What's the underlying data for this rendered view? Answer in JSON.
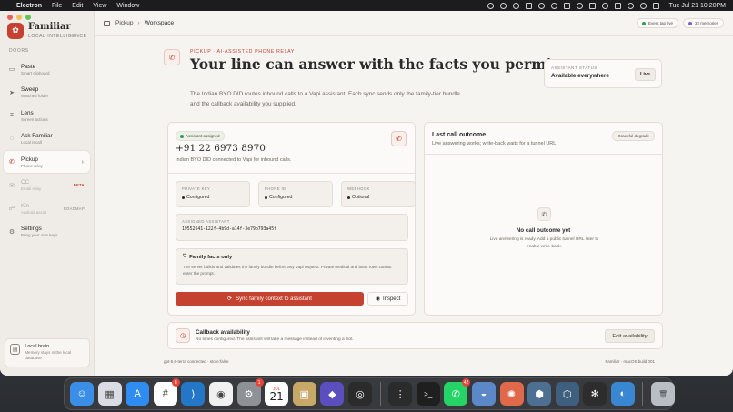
{
  "menubar": {
    "app_name": "Electron",
    "items": [
      "File",
      "Edit",
      "View",
      "Window"
    ],
    "clock": "Tue Jul 21  10:20PM"
  },
  "sidebar": {
    "brand_title": "Familiar",
    "brand_subtitle": "LOCAL INTELLIGENCE",
    "section_label": "DOORS",
    "items": [
      {
        "title": "Paste",
        "subtitle": "Smart clipboard",
        "icon": "clipboard-icon",
        "glyph": "▭"
      },
      {
        "title": "Sweep",
        "subtitle": "Watched folder",
        "icon": "send-icon",
        "glyph": "➤"
      },
      {
        "title": "Lens",
        "subtitle": "Screen actions",
        "icon": "crop-icon",
        "glyph": "⌗"
      },
      {
        "title": "Ask Familiar",
        "subtitle": "Local recall",
        "icon": "chat-icon",
        "glyph": "◌"
      },
      {
        "title": "Pickup",
        "subtitle": "Phone relay",
        "icon": "phone-icon",
        "glyph": "✆"
      },
      {
        "title": "CC",
        "subtitle": "Email relay",
        "icon": "mail-icon",
        "glyph": "✉",
        "badge": "BETA"
      },
      {
        "title": "Kin",
        "subtitle": "Android assist",
        "icon": "share-icon",
        "glyph": "☍",
        "badge": "ROADMAP"
      },
      {
        "title": "Settings",
        "subtitle": "Bring your own keys",
        "icon": "gear-icon",
        "glyph": "⚙"
      }
    ],
    "local_brain_title": "Local brain",
    "local_brain_desc": "Memory stays in the local database"
  },
  "topbar": {
    "crumb_root": "Pickup",
    "crumb_sep": "›",
    "crumb_current": "Workspace",
    "pill_event": "Event tap live",
    "pill_memories": "32 memories"
  },
  "hero": {
    "eyebrow": "PICKUP · AI-ASSISTED PHONE RELAY",
    "title": "Your line can answer with the facts you permit.",
    "description": "The Indian BYO DID routes inbound calls to a Vapi assistant. Each sync sends only the family-tier bundle and the callback availability you supplied."
  },
  "status": {
    "label": "ASSISTANT STATUS",
    "value": "Available everywhere",
    "badge": "Live"
  },
  "line_card": {
    "badge": "Assistant assigned",
    "phone": "+91 22 6973 8970",
    "description": "Indian BYO DID connected to Vapi for inbound calls.",
    "config": [
      {
        "label": "PRIVATE KEY",
        "value": "Configured"
      },
      {
        "label": "PHONE ID",
        "value": "Configured"
      },
      {
        "label": "WEBHOOK",
        "value": "Optional"
      }
    ],
    "assistant_label": "ASSIGNED ASSISTANT",
    "assistant_id": "19552641-122f-4b9d-a14f-3e79b793a45f",
    "facts_title": "Family facts only",
    "facts_desc": "The server builds and validates the family bundle before any Vapi request. Private medical and bank rows cannot enter the prompt.",
    "sync_label": "Sync family context to assistant",
    "inspect_label": "Inspect"
  },
  "outcome": {
    "title": "Last call outcome",
    "description": "Live answering works; write-back waits for a tunnel URL.",
    "pill": "Graceful degrade",
    "empty_title": "No call outcome yet",
    "empty_desc": "Live answering is ready. Add a public tunnel URL later to enable write-back."
  },
  "callback": {
    "title": "Callback availability",
    "description": "No times configured. The assistant will take a message instead of inventing a slot.",
    "button": "Edit availability"
  },
  "footer": {
    "left": "gpt-5.6-terra connected · store:false",
    "right": "Familiar · macOS build 001"
  },
  "dock": {
    "apps": [
      {
        "name": "finder-icon",
        "color": "#3a8ee6",
        "glyph": "☺"
      },
      {
        "name": "launchpad-icon",
        "color": "#d9dde3",
        "glyph": "▦"
      },
      {
        "name": "app-store-icon",
        "color": "#2f8cf0",
        "glyph": "A"
      },
      {
        "name": "slack-icon",
        "color": "#ffffff",
        "glyph": "#",
        "badge": "8"
      },
      {
        "name": "vscode-icon",
        "color": "#2477c7",
        "glyph": "⟩"
      },
      {
        "name": "chrome-icon",
        "color": "#f1f1f1",
        "glyph": "◉"
      },
      {
        "name": "system-settings-icon",
        "color": "#8e9297",
        "glyph": "⚙",
        "badge": "1"
      },
      {
        "name": "calendar-icon",
        "color": "#ffffff",
        "calendar": true
      },
      {
        "name": "preview-icon",
        "color": "#c7a869",
        "glyph": "▣"
      },
      {
        "name": "proton-vpn-icon",
        "color": "#5b4fbf",
        "glyph": "◆"
      },
      {
        "name": "davinci-icon",
        "color": "#2b2b2b",
        "glyph": "◎"
      },
      {
        "name": "sep1",
        "separator": true
      },
      {
        "name": "overflow-icon",
        "color": "#2b2b2b",
        "glyph": "⋮"
      },
      {
        "name": "terminal-icon",
        "color": "#1f1f1f",
        "glyph": ">_"
      },
      {
        "name": "whatsapp-icon",
        "color": "#25d366",
        "glyph": "✆",
        "badge": "42"
      },
      {
        "name": "disk-utility-icon",
        "color": "#5b88c7",
        "glyph": "◒"
      },
      {
        "name": "claude-icon",
        "color": "#e0684b",
        "glyph": "✺"
      },
      {
        "name": "box-icon",
        "color": "#4d6f91",
        "glyph": "⬢"
      },
      {
        "name": "cube-icon",
        "color": "#3f5f7f",
        "glyph": "⬡"
      },
      {
        "name": "openai-icon",
        "color": "#2d2d2d",
        "glyph": "✻"
      },
      {
        "name": "qbittorrent-icon",
        "color": "#3a87d1",
        "glyph": "◐"
      },
      {
        "name": "sep2",
        "separator": true
      },
      {
        "name": "trash-icon",
        "color": "#b9bec4",
        "glyph": "🗑"
      }
    ],
    "calendar_month": "JUL",
    "calendar_day": "21"
  },
  "colors": {
    "accent": "#c4422f",
    "live_dot": "#2e9b5a",
    "memories_dot": "#7b61c8"
  }
}
